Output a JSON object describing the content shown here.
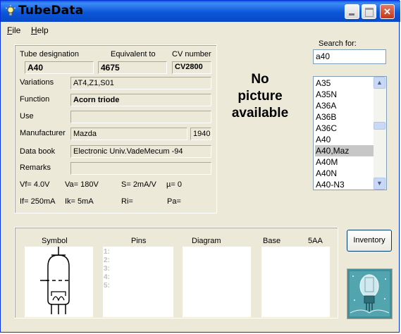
{
  "window": {
    "title": "TubeData"
  },
  "menu": {
    "file": "File",
    "help": "Help"
  },
  "tube": {
    "designation_label": "Tube designation",
    "designation": "A40",
    "equivalent_label": "Equivalent to",
    "equivalent": "4675",
    "cv_label": "CV number",
    "cv": "CV2800",
    "variations_label": "Variations",
    "variations": "AT4,Z1,S01",
    "function_label": "Function",
    "function": "Acorn triode",
    "use_label": "Use",
    "use": "",
    "manufacturer_label": "Manufacturer",
    "manufacturer": "Mazda",
    "year": "1940",
    "databook_label": "Data book",
    "databook": "Electronic Univ.VadeMecum -94",
    "remarks_label": "Remarks",
    "remarks": ""
  },
  "params": {
    "vf": "Vf= 4.0V",
    "va": "Va= 180V",
    "s": "S= 2mA/V",
    "mu": "µ=   0",
    "if": "If= 250mA",
    "ik": "Ik=   5mA",
    "ri": "Ri=",
    "pa": "Pa="
  },
  "picture": {
    "line1": "No",
    "line2": "picture",
    "line3": "available"
  },
  "search": {
    "label": "Search for:",
    "value": "a40"
  },
  "list": {
    "items": [
      "A35",
      "A35N",
      "A36A",
      "A36B",
      "A36C",
      "A40",
      "A40,Maz",
      "A40M",
      "A40N",
      "A40-N3"
    ],
    "selected_index": 6
  },
  "bottom": {
    "symbol_label": "Symbol",
    "pins_label": "Pins",
    "diagram_label": "Diagram",
    "base_label": "Base",
    "base_value": "5AA",
    "pin_numbers": [
      "1:",
      "2:",
      "3:",
      "4:",
      "5:"
    ]
  },
  "buttons": {
    "inventory": "Inventory"
  },
  "icons": {
    "title": "lightbulb-icon",
    "minimize": "minimize-icon",
    "maximize": "maximize-icon",
    "close": "close-icon",
    "scroll_up": "scroll-up-icon",
    "scroll_down": "scroll-down-icon",
    "symbol": "triode-tube-symbol",
    "logo": "tube-logo"
  },
  "colors": {
    "titlebar": "#0b57d8",
    "face": "#ece9d8",
    "selection": "#c7c7c7",
    "close": "#c2381c"
  }
}
